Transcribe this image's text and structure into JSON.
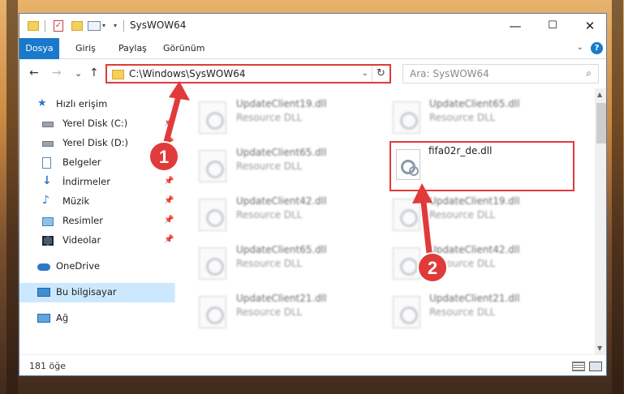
{
  "window": {
    "title": "SysWOW64",
    "controls": {
      "minimize": "—",
      "maximize": "☐",
      "close": "✕"
    }
  },
  "ribbon": {
    "tabs": [
      "Dosya",
      "Giriş",
      "Paylaş",
      "Görünüm"
    ],
    "help": "?"
  },
  "nav": {
    "back": "←",
    "forward": "→",
    "recent": "⌄",
    "up": "↑",
    "address": "C:\\Windows\\SysWOW64",
    "refresh": "↻",
    "search_placeholder": "Ara: SysWOW64",
    "search_icon": "⌕"
  },
  "sidebar": {
    "items": [
      {
        "label": "Hızlı erişim",
        "icon": "star-icon"
      },
      {
        "label": "Yerel Disk (C:)",
        "icon": "drive-icon"
      },
      {
        "label": "Yerel Disk (D:)",
        "icon": "drive-icon"
      },
      {
        "label": "Belgeler",
        "icon": "documents-icon"
      },
      {
        "label": "İndirmeler",
        "icon": "download-icon"
      },
      {
        "label": "Müzik",
        "icon": "music-icon"
      },
      {
        "label": "Resimler",
        "icon": "pictures-icon"
      },
      {
        "label": "Videolar",
        "icon": "video-icon"
      },
      {
        "label": "OneDrive",
        "icon": "cloud-icon"
      },
      {
        "label": "Bu bilgisayar",
        "icon": "computer-icon"
      },
      {
        "label": "Ağ",
        "icon": "network-icon"
      }
    ]
  },
  "files": {
    "left": [
      {
        "name": "UpdateClient19.dll",
        "type": "Resource DLL"
      },
      {
        "name": "UpdateClient65.dll",
        "type": "Resource DLL"
      },
      {
        "name": "UpdateClient42.dll",
        "type": "Resource DLL"
      },
      {
        "name": "UpdateClient65.dll",
        "type": "Resource DLL"
      },
      {
        "name": "UpdateClient21.dll",
        "type": "Resource DLL"
      }
    ],
    "right": [
      {
        "name": "UpdateClient65.dll",
        "type": "Resource DLL"
      },
      {
        "name": "fifa02r_de.dll",
        "type": ""
      },
      {
        "name": "UpdateClient19.dll",
        "type": "Resource DLL"
      },
      {
        "name": "UpdateClient42.dll",
        "type": "Resource DLL"
      },
      {
        "name": "UpdateClient21.dll",
        "type": "Resource DLL"
      }
    ]
  },
  "status": {
    "count": "181 öğe"
  },
  "annotations": {
    "step1": "1",
    "step2": "2",
    "color": "#e03a3a"
  }
}
